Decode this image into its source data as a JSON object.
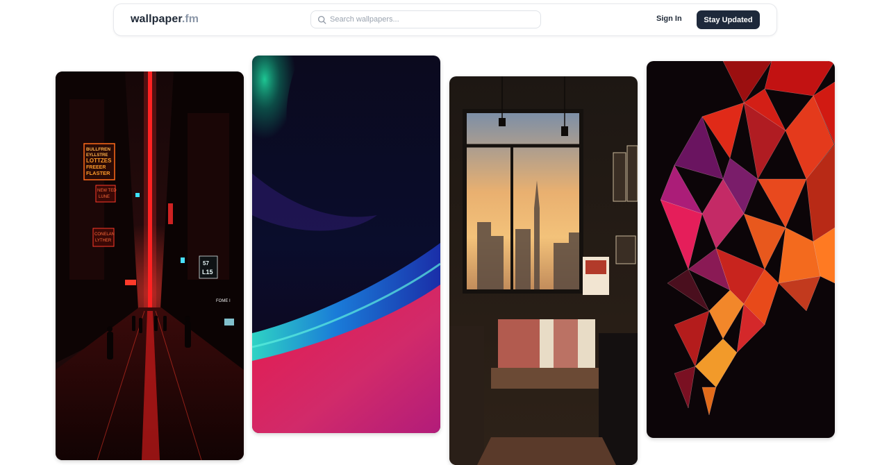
{
  "header": {
    "brand_main": "wallpaper",
    "brand_suffix": ".fm",
    "search_placeholder": "Search wallpapers...",
    "sign_in_label": "Sign In",
    "cta_label": "Stay Updated"
  },
  "gallery": {
    "cards": [
      {
        "theme": "cyberpunk-neon-street",
        "signs": [
          "BULLFREN",
          "EYLLSTRE",
          "LOTTZES",
          "FREEER",
          "FLASTER",
          "NEW TED",
          "LUNE",
          "CONELAN",
          "LYTHER",
          "57",
          "L15",
          "FOME I"
        ]
      },
      {
        "theme": "aurora-gradient"
      },
      {
        "theme": "city-loft-bedroom"
      },
      {
        "theme": "low-poly-geometric"
      }
    ]
  },
  "colors": {
    "cta_bg": "#1e293b",
    "brand_muted": "#8b97a8",
    "neon_red": "#ff2a2a",
    "aurora_green": "#16b383",
    "aurora_magenta": "#e0236b"
  }
}
